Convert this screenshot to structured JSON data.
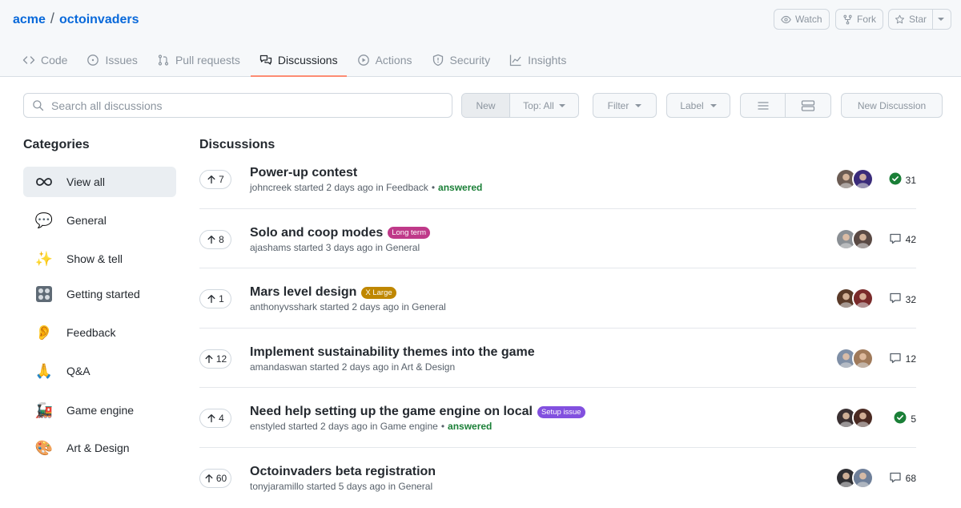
{
  "header": {
    "owner": "acme",
    "separator": "/",
    "repo": "octoinvaders",
    "watch_label": "Watch",
    "fork_label": "Fork",
    "star_label": "Star"
  },
  "tabs": [
    {
      "label": "Code",
      "icon": "code-icon"
    },
    {
      "label": "Issues",
      "icon": "issue-icon"
    },
    {
      "label": "Pull requests",
      "icon": "pull-request-icon"
    },
    {
      "label": "Discussions",
      "icon": "discussion-icon",
      "active": true
    },
    {
      "label": "Actions",
      "icon": "play-icon"
    },
    {
      "label": "Security",
      "icon": "shield-icon"
    },
    {
      "label": "Insights",
      "icon": "graph-icon"
    }
  ],
  "toolbar": {
    "search_placeholder": "Search all discussions",
    "new_label": "New",
    "top_label": "Top: All",
    "filter_label": "Filter",
    "label_label": "Label",
    "new_discussion_label": "New Discussion"
  },
  "sidebar": {
    "title": "Categories",
    "items": [
      {
        "label": "View all",
        "emoji": "∞",
        "active": true
      },
      {
        "label": "General",
        "emoji": "💬"
      },
      {
        "label": "Show & tell",
        "emoji": "✨"
      },
      {
        "label": "Getting started",
        "emoji": "🎛"
      },
      {
        "label": "Feedback",
        "emoji": "👂"
      },
      {
        "label": "Q&A",
        "emoji": "🙏"
      },
      {
        "label": "Game engine",
        "emoji": "🚂"
      },
      {
        "label": "Art & Design",
        "emoji": "🎨"
      }
    ]
  },
  "discussions": {
    "title": "Discussions",
    "items": [
      {
        "votes": "7",
        "title": "Power-up contest",
        "badge": "",
        "badge_color": "",
        "author": "johncreek",
        "meta": "johncreek started 2 days ago in Feedback",
        "answered": "answered",
        "stat_type": "answered",
        "count": "31"
      },
      {
        "votes": "8",
        "title": "Solo and coop modes",
        "badge": "Long term",
        "badge_color": "#bf3989",
        "author": "ajashams",
        "meta": "ajashams started 3 days ago in General",
        "answered": "",
        "stat_type": "comments",
        "count": "42"
      },
      {
        "votes": "1",
        "title": "Mars level design",
        "badge": "X Large",
        "badge_color": "#bf8700",
        "author": "anthonyvsshark",
        "meta": "anthonyvsshark started 2 days ago in General",
        "answered": "",
        "stat_type": "comments",
        "count": "32"
      },
      {
        "votes": "12",
        "title": "Implement sustainability themes into the game",
        "badge": "",
        "badge_color": "",
        "author": "amandaswan",
        "meta": "amandaswan started 2 days ago in Art & Design",
        "answered": "",
        "stat_type": "comments",
        "count": "12"
      },
      {
        "votes": "4",
        "title": "Need help setting up the game engine on local",
        "badge": "Setup issue",
        "badge_color": "#8250df",
        "author": "enstyled",
        "meta": "enstyled started 2 days ago in Game engine",
        "answered": "answered",
        "stat_type": "answered",
        "count": "5"
      },
      {
        "votes": "60",
        "title": "Octoinvaders beta registration",
        "badge": "",
        "badge_color": "",
        "author": "tonyjaramillo",
        "meta": "tonyjaramillo started 5 days ago in General",
        "answered": "",
        "stat_type": "comments",
        "count": "68"
      }
    ]
  },
  "colors": {
    "link": "#0969da",
    "tab_underline": "#fd8c73",
    "answered": "#1a7f37"
  }
}
